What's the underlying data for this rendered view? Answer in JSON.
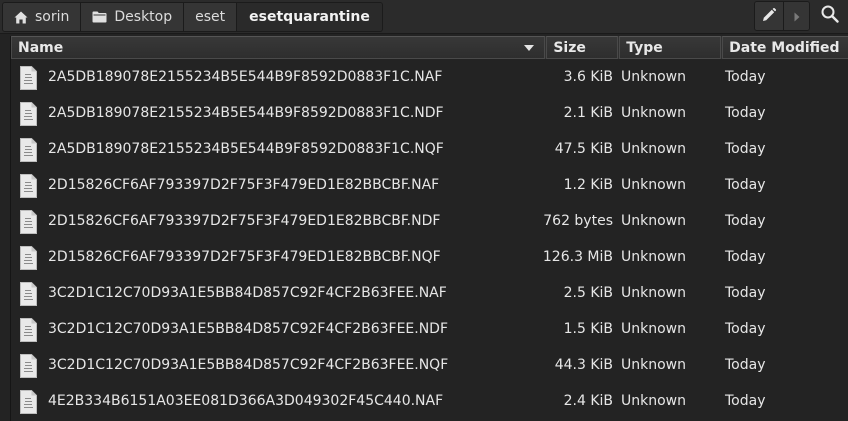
{
  "pathbar": {
    "crumbs": [
      {
        "label": "sorin",
        "icon": "home-icon"
      },
      {
        "label": "Desktop",
        "icon": "folder-icon"
      },
      {
        "label": "eset"
      },
      {
        "label": "esetquarantine",
        "active": true
      }
    ],
    "tools": [
      "edit-path-icon",
      "chevron-right-icon",
      "search-icon"
    ]
  },
  "columns": {
    "name": "Name",
    "size": "Size",
    "type": "Type",
    "date": "Date Modified"
  },
  "sort": {
    "column": "Name",
    "direction": "descending-indicator"
  },
  "files": [
    {
      "name": "2A5DB189078E2155234B5E544B9F8592D0883F1C.NAF",
      "size": "3.6 KiB",
      "type": "Unknown",
      "date": "Today"
    },
    {
      "name": "2A5DB189078E2155234B5E544B9F8592D0883F1C.NDF",
      "size": "2.1 KiB",
      "type": "Unknown",
      "date": "Today"
    },
    {
      "name": "2A5DB189078E2155234B5E544B9F8592D0883F1C.NQF",
      "size": "47.5 KiB",
      "type": "Unknown",
      "date": "Today"
    },
    {
      "name": "2D15826CF6AF793397D2F75F3F479ED1E82BBCBF.NAF",
      "size": "1.2 KiB",
      "type": "Unknown",
      "date": "Today"
    },
    {
      "name": "2D15826CF6AF793397D2F75F3F479ED1E82BBCBF.NDF",
      "size": "762 bytes",
      "type": "Unknown",
      "date": "Today"
    },
    {
      "name": "2D15826CF6AF793397D2F75F3F479ED1E82BBCBF.NQF",
      "size": "126.3 MiB",
      "type": "Unknown",
      "date": "Today"
    },
    {
      "name": "3C2D1C12C70D93A1E5BB84D857C92F4CF2B63FEE.NAF",
      "size": "2.5 KiB",
      "type": "Unknown",
      "date": "Today"
    },
    {
      "name": "3C2D1C12C70D93A1E5BB84D857C92F4CF2B63FEE.NDF",
      "size": "1.5 KiB",
      "type": "Unknown",
      "date": "Today"
    },
    {
      "name": "3C2D1C12C70D93A1E5BB84D857C92F4CF2B63FEE.NQF",
      "size": "44.3 KiB",
      "type": "Unknown",
      "date": "Today"
    },
    {
      "name": "4E2B334B6151A03EE081D366A3D049302F45C440.NAF",
      "size": "2.4 KiB",
      "type": "Unknown",
      "date": "Today"
    }
  ],
  "colors": {
    "background": "#232323",
    "header": "#313131",
    "text": "#e6e6e6"
  }
}
